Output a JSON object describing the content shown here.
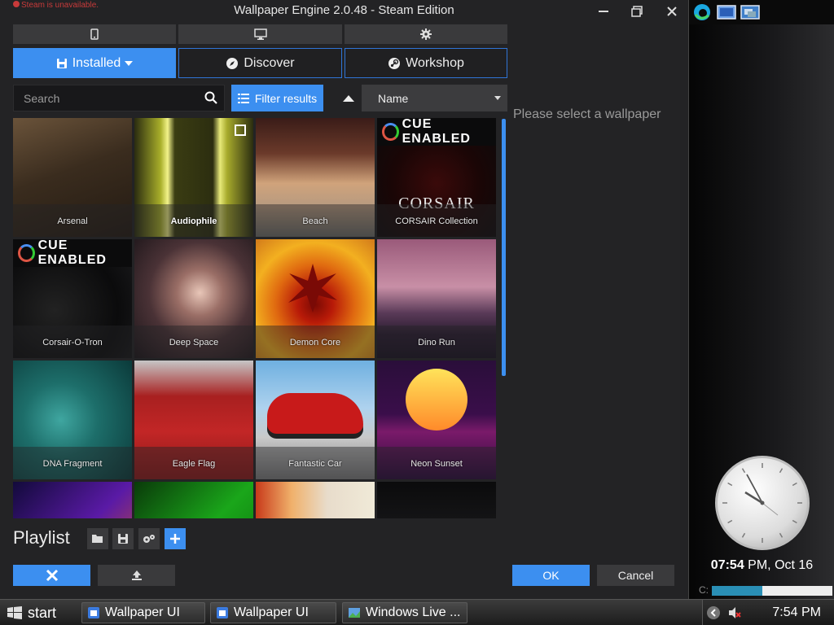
{
  "window": {
    "title": "Wallpaper Engine 2.0.48 - Steam Edition",
    "steam_warning": "Steam is unavailable."
  },
  "tabs": {
    "installed": "Installed",
    "discover": "Discover",
    "workshop": "Workshop"
  },
  "search": {
    "placeholder": "Search"
  },
  "filter": {
    "label": "Filter results"
  },
  "sort": {
    "value": "Name"
  },
  "detail": {
    "placeholder": "Please select a wallpaper"
  },
  "wallpapers": [
    {
      "label": "Arsenal",
      "art": "arsenal"
    },
    {
      "label": "Audiophile",
      "art": "audiophile",
      "selected": true
    },
    {
      "label": "Beach",
      "art": "beach"
    },
    {
      "label": "CORSAIR Collection",
      "art": "corsair",
      "badge": "CUE ENABLED",
      "logo": "CORSAIR"
    },
    {
      "label": "Corsair-O-Tron",
      "art": "corsairtron",
      "badge": "CUE ENABLED"
    },
    {
      "label": "Deep Space",
      "art": "deepspace"
    },
    {
      "label": "Demon Core",
      "art": "demoncore"
    },
    {
      "label": "Dino Run",
      "art": "dinorun"
    },
    {
      "label": "DNA Fragment",
      "art": "dna"
    },
    {
      "label": "Eagle Flag",
      "art": "eagle"
    },
    {
      "label": "Fantastic Car",
      "art": "car"
    },
    {
      "label": "Neon Sunset",
      "art": "neon"
    },
    {
      "label": "",
      "art": "partial1"
    },
    {
      "label": "",
      "art": "partial2"
    },
    {
      "label": "",
      "art": "partial3"
    },
    {
      "label": "",
      "art": "partial4"
    }
  ],
  "playlist": {
    "title": "Playlist"
  },
  "buttons": {
    "ok": "OK",
    "cancel": "Cancel"
  },
  "sidebar": {
    "clock_time": "07:54",
    "clock_suffix": "PM, Oct 16",
    "drive_label": "C:",
    "drive_usage": 0.42
  },
  "taskbar": {
    "start": "start",
    "tasks": [
      {
        "label": "Wallpaper UI"
      },
      {
        "label": "Wallpaper UI"
      },
      {
        "label": "Windows Live ..."
      }
    ],
    "time": "7:54 PM"
  },
  "colors": {
    "accent": "#3c8ff0",
    "background": "#232325",
    "warning": "#c83a3a"
  }
}
